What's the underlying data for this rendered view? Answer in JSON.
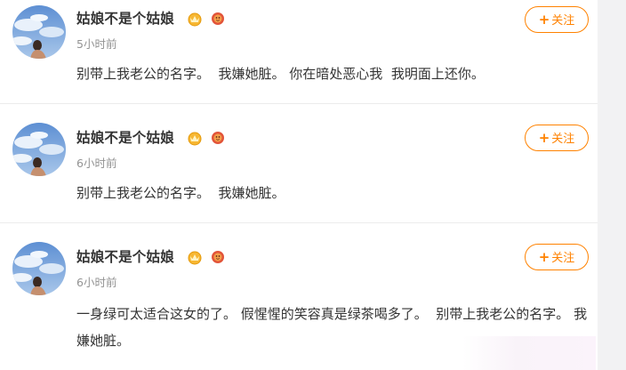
{
  "posts": [
    {
      "username": "姑娘不是个姑娘",
      "time": "5小时前",
      "content": "别带上我老公的名字。  我嫌她脏。 你在暗处恶心我  我明面上还你。",
      "follow_label": "关注",
      "follow_plus": "+"
    },
    {
      "username": "姑娘不是个姑娘",
      "time": "6小时前",
      "content": "别带上我老公的名字。  我嫌她脏。",
      "follow_label": "关注",
      "follow_plus": "+"
    },
    {
      "username": "姑娘不是个姑娘",
      "time": "6小时前",
      "content": "一身绿可太适合这女的了。 假惺惺的笑容真是绿茶喝多了。  别带上我老公的名字。 我嫌她脏。",
      "follow_label": "关注",
      "follow_plus": "+"
    }
  ],
  "badges": {
    "crown_icon": "crown-badge-icon",
    "lion_icon": "red-lion-badge-icon"
  },
  "colors": {
    "accent": "#ff8200",
    "text": "#333333",
    "muted": "#939393",
    "divider": "#ececec"
  }
}
